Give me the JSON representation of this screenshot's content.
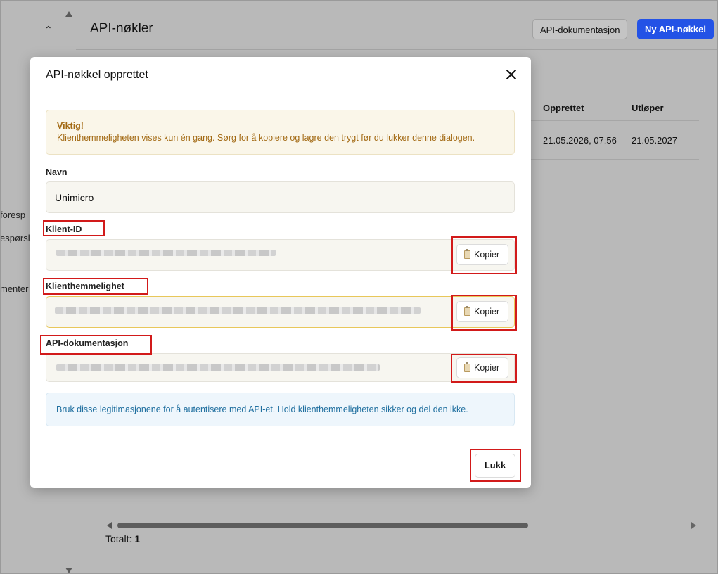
{
  "page": {
    "title": "API-nøkler",
    "side_texts": [
      "foresp",
      "espørsl",
      "menter"
    ],
    "header_buttons": {
      "docs": "API-dokumentasjon",
      "new_key": "Ny API-nøkkel"
    },
    "table": {
      "columns": [
        "Opprettet",
        "Utløper"
      ],
      "rows": [
        {
          "created": "21.05.2026, 07:56",
          "expires": "21.05.2027"
        }
      ]
    },
    "total_label": "Totalt:",
    "total_value": "1"
  },
  "modal": {
    "title": "API-nøkkel opprettet",
    "warning": {
      "title": "Viktig!",
      "text": "Klienthemmeligheten vises kun én gang. Sørg for å kopiere og lagre den trygt før du lukker denne dialogen."
    },
    "name_label": "Navn",
    "name_value": "Unimicro",
    "client_id_label": "Klient-ID",
    "client_secret_label": "Klienthemmelighet",
    "api_docs_label": "API-dokumentasjon",
    "copy_label": "Kopier",
    "info": "Bruk disse legitimasjonene for å autentisere med API-et. Hold klienthemmeligheten sikker og del den ikke.",
    "close_label": "Lukk"
  },
  "colors": {
    "accent": "#2352e6",
    "warning_text": "#a36a14",
    "info_text": "#1f6f9f",
    "highlight": "#d21a1a"
  }
}
